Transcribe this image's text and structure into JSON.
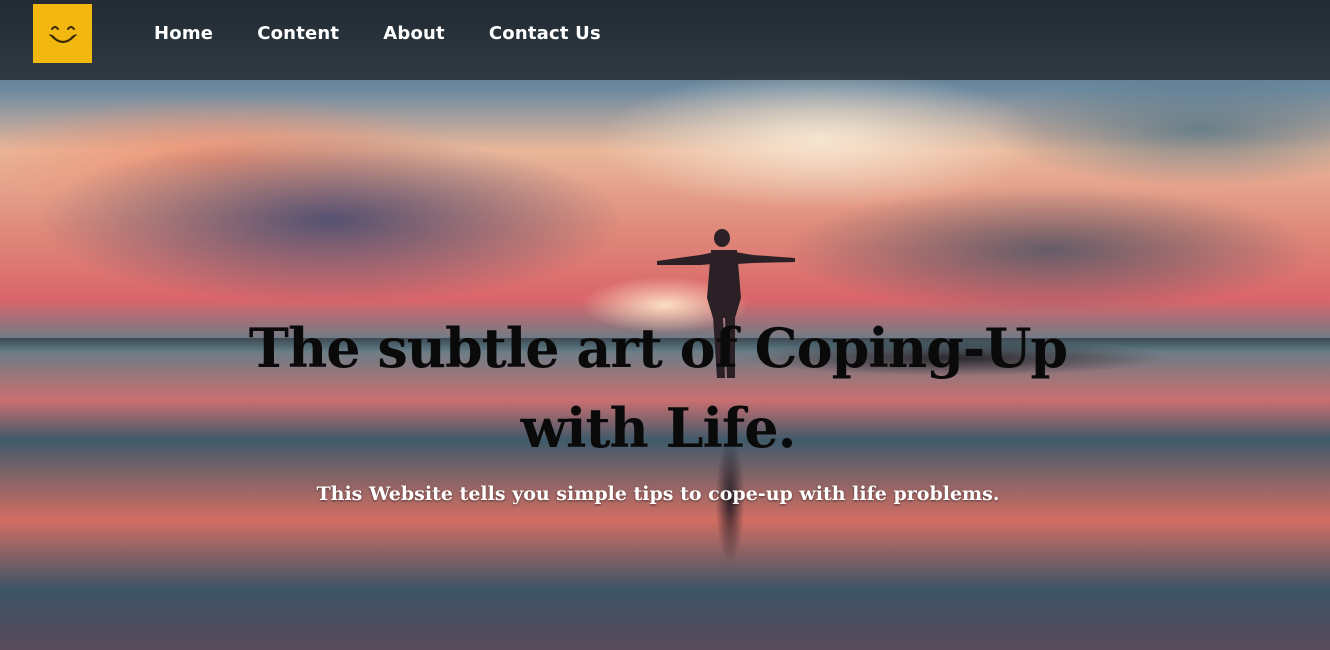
{
  "nav": {
    "logo_icon": "smiley-face-icon",
    "logo_color": "#f2b80f",
    "items": [
      {
        "label": "Home"
      },
      {
        "label": "Content"
      },
      {
        "label": "About"
      },
      {
        "label": "Contact Us"
      }
    ]
  },
  "hero": {
    "title": "The subtle art of Coping-Up with Life.",
    "subtitle": "This Website tells you simple tips to cope-up with life problems.",
    "background_image": "sunset-beach-person-silhouette"
  }
}
